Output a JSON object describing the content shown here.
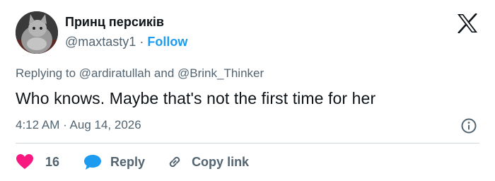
{
  "author": {
    "name": "Принц персиків",
    "handle": "@maxtasty1",
    "separator": "·",
    "follow_label": "Follow"
  },
  "reply_context": {
    "prefix": "Replying to",
    "mention_1": "@ardiratullah",
    "conjunction": "and",
    "mention_2": "@Brink_Thinker"
  },
  "tweet": {
    "text": "Who knows. Maybe that's not the first time for her",
    "timestamp": "4:12 AM · Aug 14, 2026"
  },
  "actions": {
    "like_count": "16",
    "reply_label": "Reply",
    "copy_link_label": "Copy link"
  },
  "icons": {
    "brand": "x-logo-icon",
    "info": "info-icon",
    "like": "heart-icon",
    "reply": "speech-bubble-icon",
    "copy": "link-icon"
  },
  "colors": {
    "accent": "#1d9bf0",
    "like": "#f91880",
    "text": "#0f1419",
    "muted": "#536471",
    "divider": "#cfd9de"
  }
}
